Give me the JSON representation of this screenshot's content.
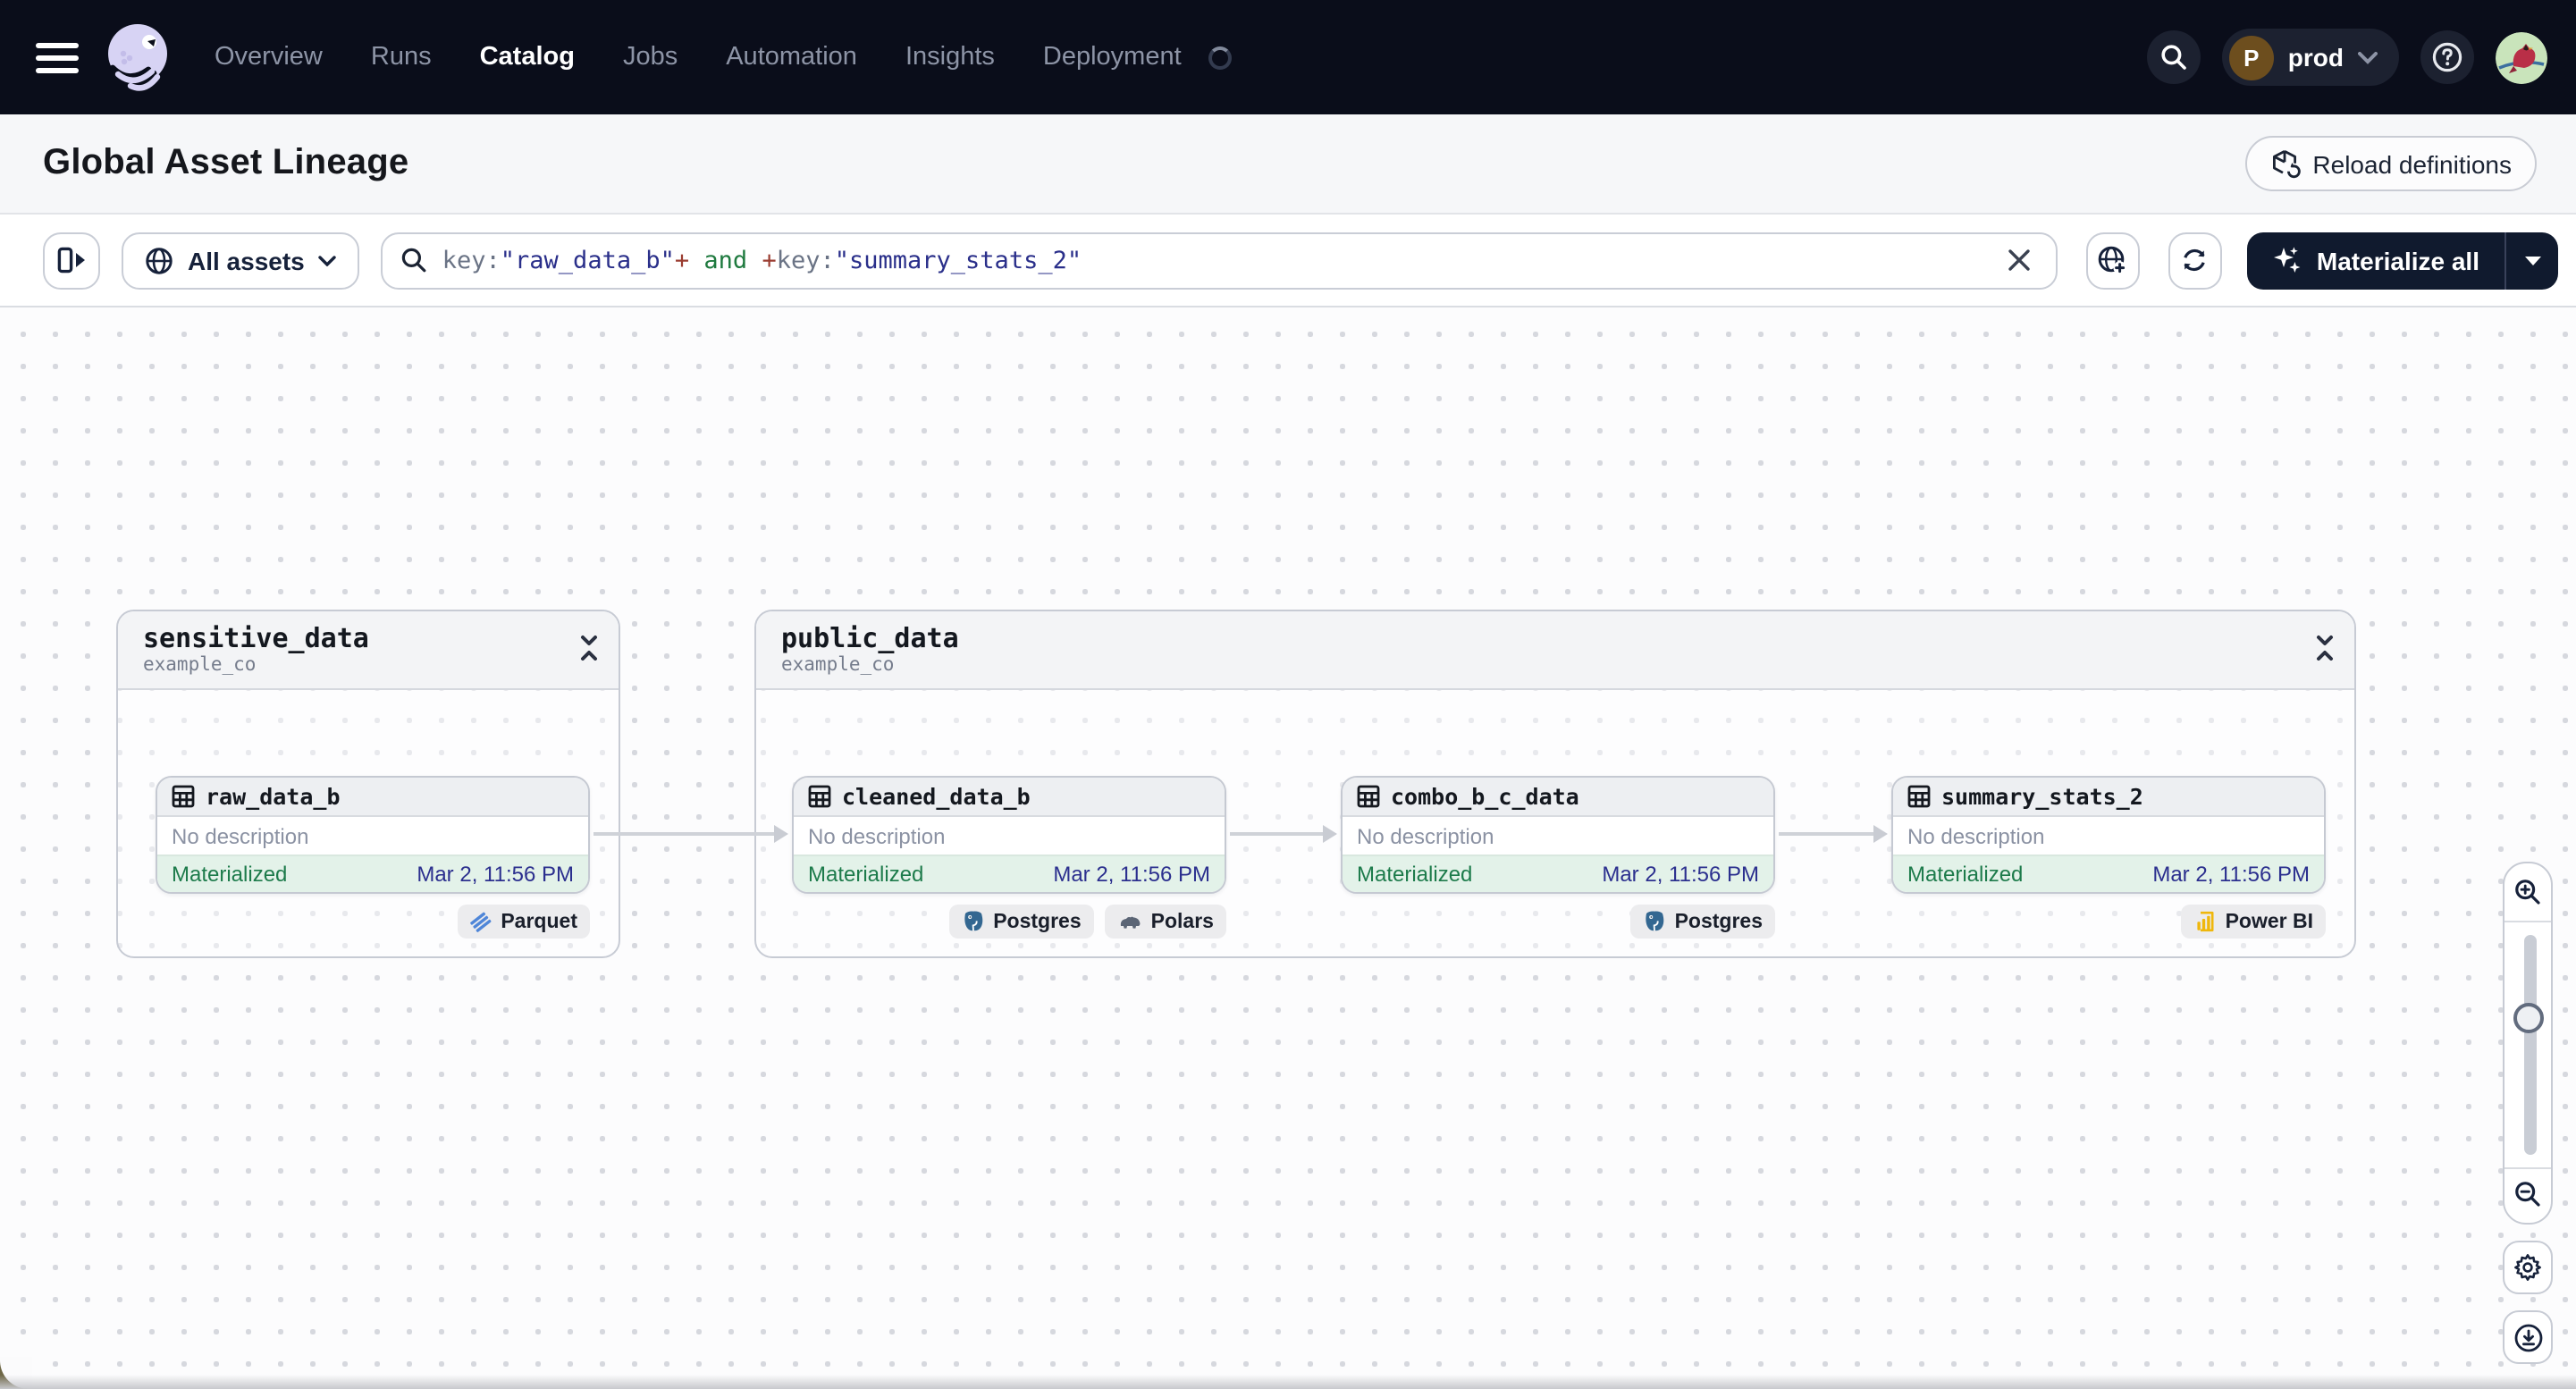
{
  "nav": {
    "items": [
      "Overview",
      "Runs",
      "Catalog",
      "Jobs",
      "Automation",
      "Insights",
      "Deployment"
    ],
    "active_item": "Catalog",
    "deployment": {
      "initial": "P",
      "label": "prod"
    }
  },
  "header": {
    "title": "Global Asset Lineage",
    "reload_label": "Reload definitions"
  },
  "toolbar": {
    "scope_label": "All assets",
    "materialize_label": "Materialize all",
    "query": {
      "tokens": [
        {
          "text": "key:",
          "type": "key"
        },
        {
          "text": "\"raw_data_b\"",
          "type": "string"
        },
        {
          "text": "+",
          "type": "plus"
        },
        {
          "text": " and ",
          "type": "and"
        },
        {
          "text": "+",
          "type": "plus"
        },
        {
          "text": "key:",
          "type": "key"
        },
        {
          "text": "\"summary_stats_2\"",
          "type": "string"
        }
      ]
    }
  },
  "graph": {
    "groups": [
      {
        "title": "sensitive_data",
        "subtitle": "example_co"
      },
      {
        "title": "public_data",
        "subtitle": "example_co"
      }
    ],
    "assets": [
      {
        "name": "raw_data_b",
        "description": "No description",
        "status": "Materialized",
        "timestamp": "Mar 2, 11:56 PM",
        "tags": [
          {
            "label": "Parquet",
            "icon": "parquet"
          }
        ]
      },
      {
        "name": "cleaned_data_b",
        "description": "No description",
        "status": "Materialized",
        "timestamp": "Mar 2, 11:56 PM",
        "tags": [
          {
            "label": "Postgres",
            "icon": "postgres"
          },
          {
            "label": "Polars",
            "icon": "polars"
          }
        ]
      },
      {
        "name": "combo_b_c_data",
        "description": "No description",
        "status": "Materialized",
        "timestamp": "Mar 2, 11:56 PM",
        "tags": [
          {
            "label": "Postgres",
            "icon": "postgres"
          }
        ]
      },
      {
        "name": "summary_stats_2",
        "description": "No description",
        "status": "Materialized",
        "timestamp": "Mar 2, 11:56 PM",
        "tags": [
          {
            "label": "Power BI",
            "icon": "powerbi"
          }
        ]
      }
    ]
  },
  "colors": {
    "nav_bg": "#0a0d1a",
    "materialize_bg": "#101a2e",
    "status_green": "#1d7b4b",
    "timestamp_blue": "#2b2f8e",
    "query_string_blue": "#2a2f8a",
    "query_plus_red": "#9a3c30",
    "query_and_green": "#1f7a3f",
    "parquet_blue": "#4f86d8",
    "postgres_blue": "#336791",
    "powerbi_yellow": "#efb70c"
  }
}
